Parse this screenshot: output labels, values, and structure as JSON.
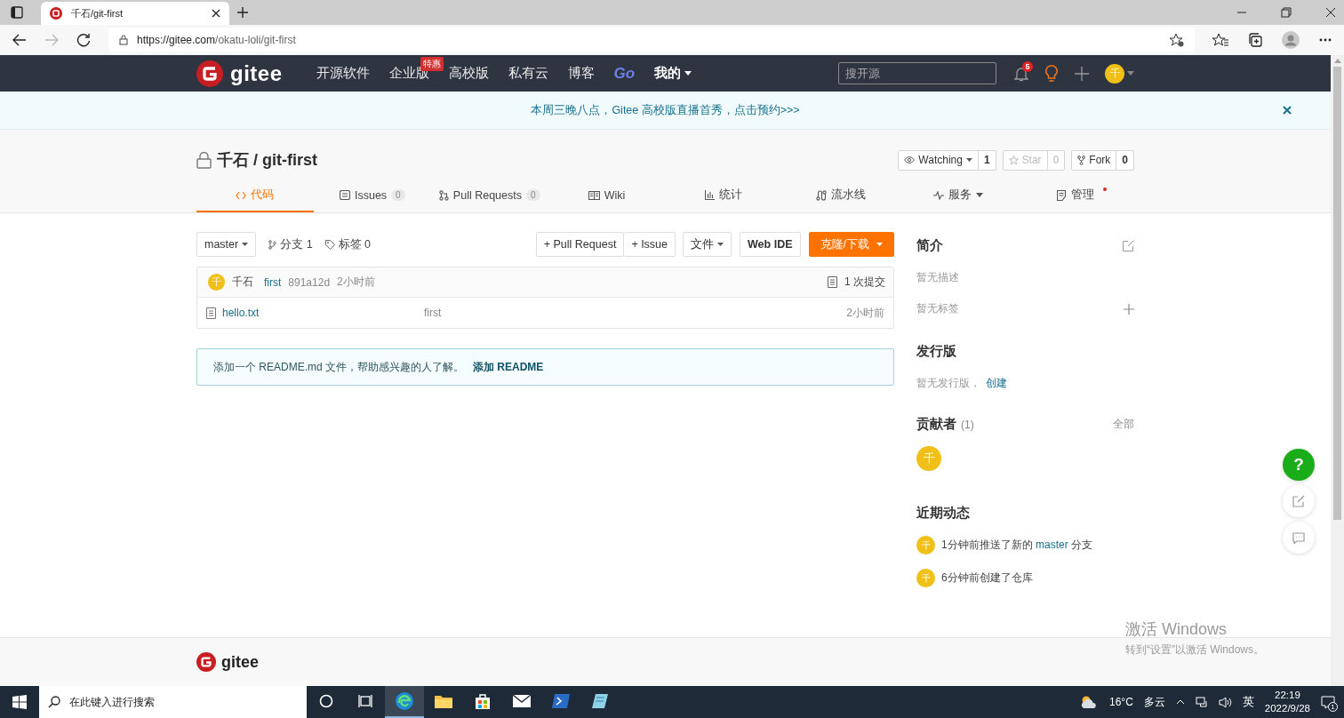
{
  "browser": {
    "tab_title": "千石/git-first",
    "url_host": "https://gitee.com",
    "url_path": "/okatu-loli/git-first"
  },
  "nav": {
    "logo": "gitee",
    "items": [
      {
        "label": "开源软件",
        "kind": "text"
      },
      {
        "label": "企业版",
        "kind": "text",
        "badge": "特惠"
      },
      {
        "label": "高校版",
        "kind": "text"
      },
      {
        "label": "私有云",
        "kind": "text"
      },
      {
        "label": "博客",
        "kind": "text"
      },
      {
        "label": "Go",
        "kind": "brand"
      },
      {
        "label": "我的",
        "kind": "menu"
      }
    ],
    "search": {
      "placeholder": "搜开源"
    },
    "notifications": "5",
    "avatar": "千"
  },
  "banner": {
    "text": "本周三晚八点，Gitee 高校版直播首秀，点击预约>>>"
  },
  "repo": {
    "title": "千石 / git-first",
    "private": true,
    "actions": [
      {
        "label": "Watching",
        "count": "1",
        "dropdown": true,
        "disabled": false
      },
      {
        "label": "Star",
        "count": "0",
        "dropdown": false,
        "disabled": true
      },
      {
        "label": "Fork",
        "count": "0",
        "dropdown": false,
        "disabled": false
      }
    ],
    "tabs": [
      {
        "label": "代码",
        "kind": "code",
        "selected": true
      },
      {
        "label": "Issues",
        "kind": "issues",
        "count": "0",
        "selected": false
      },
      {
        "label": "Pull Requests",
        "kind": "pr",
        "count": "0",
        "selected": false
      },
      {
        "label": "Wiki",
        "kind": "wiki",
        "selected": false
      },
      {
        "label": "统计",
        "kind": "stats",
        "selected": false
      },
      {
        "label": "流水线",
        "kind": "pipeline",
        "selected": false
      },
      {
        "label": "服务",
        "kind": "service",
        "dropdown": true,
        "selected": false
      },
      {
        "label": "管理",
        "kind": "manage",
        "dot": true,
        "selected": false
      }
    ]
  },
  "toolbar": {
    "branch": "master",
    "branches": "分支 1",
    "tags": "标签 0",
    "pull_request": "+ Pull Request",
    "issue": "+ Issue",
    "file_menu": "文件",
    "web_ide": "Web IDE",
    "clone": "克隆/下载"
  },
  "commit": {
    "avatar": "千",
    "author": "千石",
    "message": "first",
    "hash": "891a12d",
    "time": "2小时前",
    "count": "1 次提交"
  },
  "files": [
    {
      "name": "hello.txt",
      "message": "first",
      "time": "2小时前"
    }
  ],
  "readme_notice": {
    "text": "添加一个 README.md 文件，帮助感兴趣的人了解。",
    "link": "添加 README"
  },
  "sidebar": {
    "intro": {
      "title": "简介",
      "description": "暂无描述",
      "tags": "暂无标签"
    },
    "releases": {
      "title": "发行版",
      "text": "暂无发行版，",
      "link": "创建"
    },
    "contributors": {
      "title": "贡献者",
      "count": "(1)",
      "all": "全部",
      "avatars": [
        "千"
      ]
    },
    "activity": {
      "title": "近期动态",
      "items": [
        {
          "avatar": "千",
          "before": "1分钟前推送了新的 ",
          "link": "master",
          "after": " 分支"
        },
        {
          "avatar": "千",
          "before": "6分钟前创建了仓库"
        }
      ]
    }
  },
  "help_button": "?",
  "footer": {
    "logo": "gitee"
  },
  "activation": {
    "title": "激活 Windows",
    "hint": "转到“设置”以激活 Windows。"
  },
  "taskbar": {
    "search_placeholder": "在此键入进行搜索",
    "apps": [
      {
        "kind": "cortana",
        "active": false
      },
      {
        "kind": "taskview",
        "active": false
      },
      {
        "kind": "edge",
        "active": true
      },
      {
        "kind": "folder",
        "active": false
      },
      {
        "kind": "store",
        "active": false
      },
      {
        "kind": "mail",
        "active": false
      },
      {
        "kind": "terminal",
        "active": false
      },
      {
        "kind": "notes",
        "active": false
      }
    ],
    "temperature": "16°C",
    "weather": "多云",
    "ime": "英",
    "time": "22:19",
    "date": "2022/9/28",
    "notifications": "1"
  }
}
